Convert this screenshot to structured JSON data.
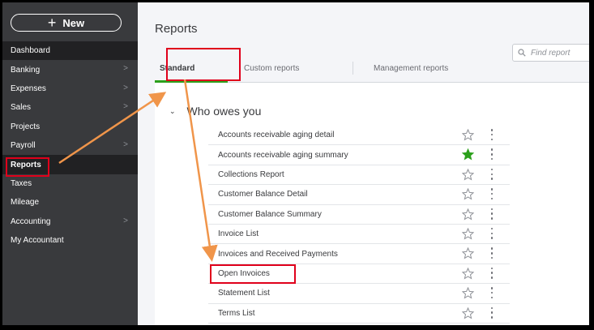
{
  "sidebar": {
    "new_button": {
      "label": "New",
      "icon": "plus-icon"
    },
    "items": [
      {
        "label": "Dashboard",
        "chevron": false
      },
      {
        "label": "Banking",
        "chevron": true
      },
      {
        "label": "Expenses",
        "chevron": true
      },
      {
        "label": "Sales",
        "chevron": true
      },
      {
        "label": "Projects",
        "chevron": false
      },
      {
        "label": "Payroll",
        "chevron": true
      },
      {
        "label": "Reports",
        "chevron": false
      },
      {
        "label": "Taxes",
        "chevron": false
      },
      {
        "label": "Mileage",
        "chevron": false
      },
      {
        "label": "Accounting",
        "chevron": true
      },
      {
        "label": "My Accountant",
        "chevron": false
      }
    ],
    "chevron_glyph": ">"
  },
  "header": {
    "title": "Reports",
    "search_placeholder": "Find report"
  },
  "tabs": [
    {
      "label": "Standard",
      "active": true
    },
    {
      "label": "Custom reports",
      "active": false
    },
    {
      "label": "Management reports",
      "active": false
    }
  ],
  "section": {
    "title": "Who owes you",
    "expanded": true
  },
  "reports": [
    {
      "label": "Accounts receivable aging detail",
      "favorite": false
    },
    {
      "label": "Accounts receivable aging summary",
      "favorite": true
    },
    {
      "label": "Collections Report",
      "favorite": false
    },
    {
      "label": "Customer Balance Detail",
      "favorite": false
    },
    {
      "label": "Customer Balance Summary",
      "favorite": false
    },
    {
      "label": "Invoice List",
      "favorite": false
    },
    {
      "label": "Invoices and Received Payments",
      "favorite": false
    },
    {
      "label": "Open Invoices",
      "favorite": false
    },
    {
      "label": "Statement List",
      "favorite": false
    },
    {
      "label": "Terms List",
      "favorite": false
    }
  ],
  "colors": {
    "sidebar_bg": "#393a3d",
    "active_tab_accent": "#2ca01c",
    "favorite_star": "#2ca01c",
    "highlight_box": "#e0001b",
    "annotation_arrow": "#f0954a"
  }
}
